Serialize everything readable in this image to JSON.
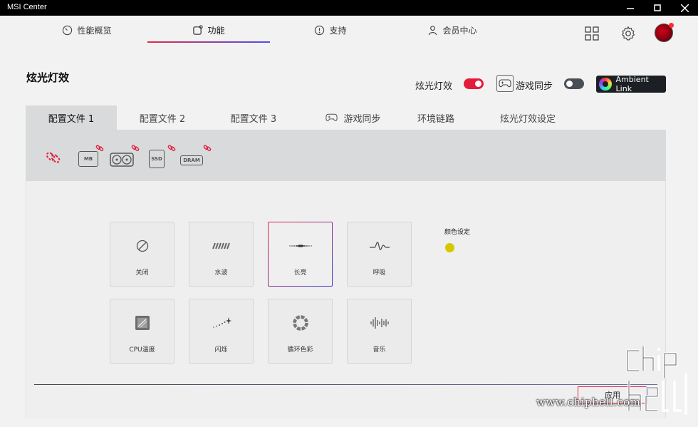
{
  "window": {
    "title": "MSI Center"
  },
  "nav": {
    "tabs": [
      {
        "label": "性能概览",
        "icon": "gauge-icon"
      },
      {
        "label": "功能",
        "icon": "feature-icon",
        "active": true
      },
      {
        "label": "支持",
        "icon": "support-icon"
      },
      {
        "label": "会员中心",
        "icon": "user-icon"
      }
    ]
  },
  "page": {
    "title": "炫光灯效",
    "toggle_lighting_label": "炫光灯效",
    "toggle_lighting_on": true,
    "toggle_gamesync_label": "游戏同步",
    "toggle_gamesync_on": false,
    "ambient_link_label": "Ambient Link"
  },
  "subtabs": [
    {
      "label": "配置文件 1",
      "active": true
    },
    {
      "label": "配置文件 2"
    },
    {
      "label": "配置文件 3"
    },
    {
      "label": "游戏同步",
      "icon": "gamepad-icon"
    },
    {
      "label": "环境链路"
    },
    {
      "label": "炫光灯效设定"
    }
  ],
  "devices": [
    {
      "name": "link-all",
      "icon": "link-icon"
    },
    {
      "name": "motherboard",
      "label": "MB"
    },
    {
      "name": "graphics-card",
      "label": ""
    },
    {
      "name": "ssd",
      "label": "SSD"
    },
    {
      "name": "dram",
      "label": "DRAM"
    }
  ],
  "effects": [
    {
      "label": "关闭",
      "icon": "off-icon"
    },
    {
      "label": "水波",
      "icon": "wave-icon"
    },
    {
      "label": "长亮",
      "icon": "steady-icon",
      "selected": true
    },
    {
      "label": "呼吸",
      "icon": "breathing-icon"
    },
    {
      "label": "CPU温度",
      "icon": "cpu-temp-icon"
    },
    {
      "label": "闪烁",
      "icon": "flash-icon"
    },
    {
      "label": "循环色彩",
      "icon": "color-cycle-icon"
    },
    {
      "label": "音乐",
      "icon": "music-icon"
    }
  ],
  "color_setting": {
    "label": "颜色设定",
    "color": "#d6c800"
  },
  "apply_label": "应用",
  "watermark": {
    "text": "www.chiphell.com"
  },
  "colors": {
    "accent_red": "#e41b3c",
    "accent_blue": "#4f4ff0",
    "titlebar": "#000000"
  }
}
